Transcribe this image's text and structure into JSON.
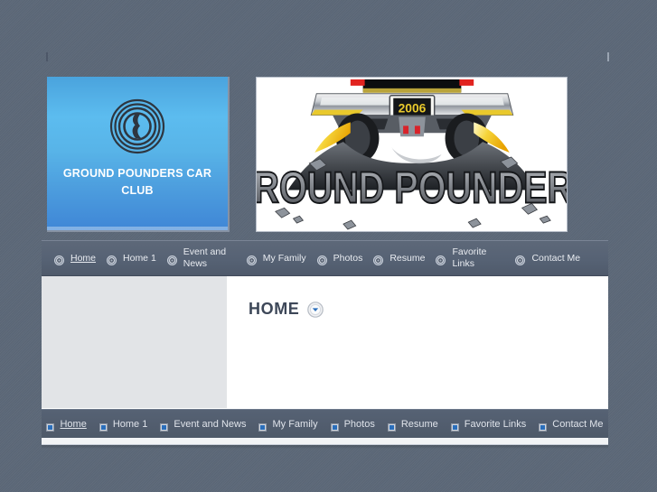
{
  "site": {
    "logo_icon": "concentric-rings-logo-icon",
    "title": "GROUND POUNDERS CAR CLUB",
    "banner": {
      "icon": "ground-pounders-car-banner-image",
      "wordmark": "GROUND POUNDERS",
      "plate_text": "2006"
    }
  },
  "top_nav": {
    "bullet_icon": "target-bullet-icon",
    "items": [
      {
        "label": "Home",
        "current": true
      },
      {
        "label": "Home 1",
        "current": false
      },
      {
        "label": "Event and News",
        "current": false
      },
      {
        "label": "My Family",
        "current": false
      },
      {
        "label": "Photos",
        "current": false
      },
      {
        "label": "Resume",
        "current": false
      },
      {
        "label": "Favorite Links",
        "current": false
      },
      {
        "label": "Contact Me",
        "current": false
      }
    ]
  },
  "main": {
    "heading": "HOME",
    "heading_toggle_icon": "chevron-down-icon"
  },
  "bottom_nav": {
    "bullet_icon": "square-bullet-icon",
    "items": [
      {
        "label": "Home",
        "current": true
      },
      {
        "label": "Home 1",
        "current": false
      },
      {
        "label": "Event and News",
        "current": false
      },
      {
        "label": "My Family",
        "current": false
      },
      {
        "label": "Photos",
        "current": false
      },
      {
        "label": "Resume",
        "current": false
      },
      {
        "label": "Favorite Links",
        "current": false
      },
      {
        "label": "Contact Me",
        "current": false
      }
    ]
  },
  "colors": {
    "page_background": "#5c6878",
    "nav_background": "#566274",
    "logo_tile_blue": "#4aa3dd",
    "sidebar_gray": "#e2e4e7",
    "heading_text": "#3d4758",
    "accent_blue": "#2a6ebb"
  }
}
